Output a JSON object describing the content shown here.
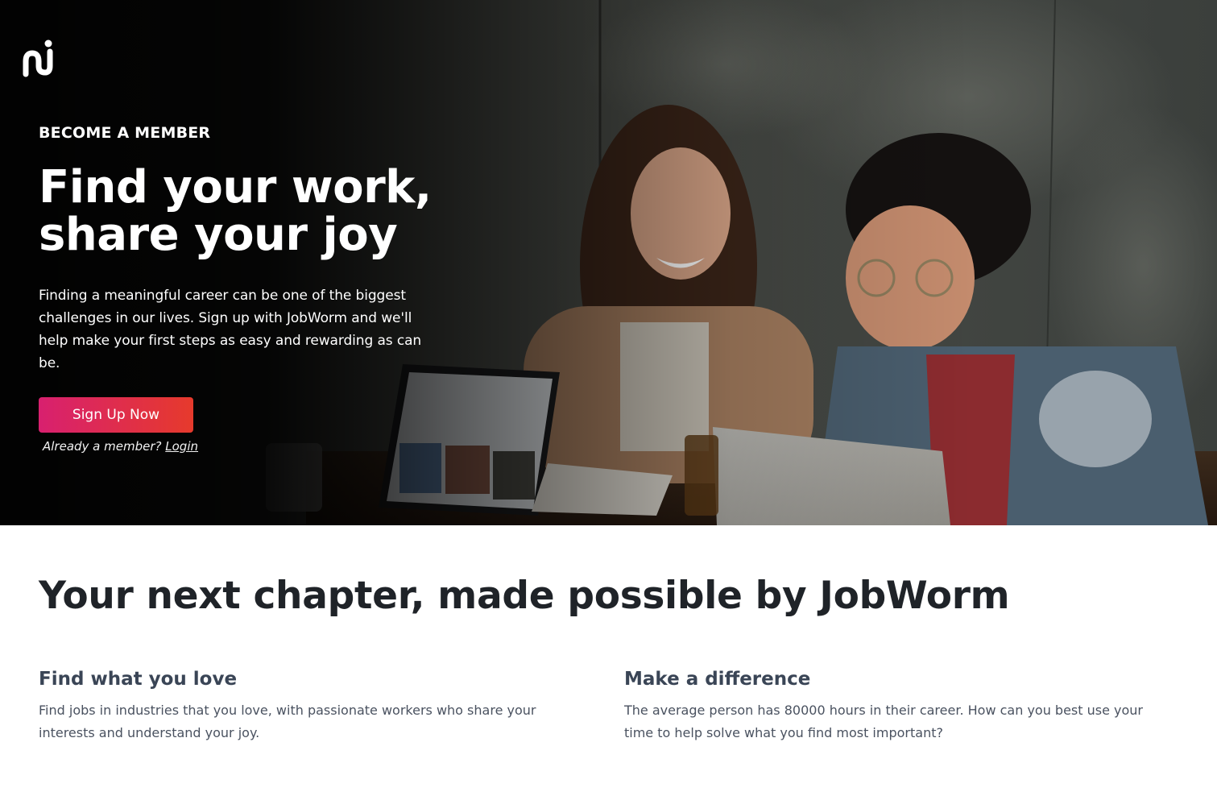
{
  "brand": {
    "logo_icon": "jobworm-logo-icon",
    "accent_start": "#d8206f",
    "accent_end": "#e63a2c"
  },
  "hero": {
    "eyebrow": "BECOME A MEMBER",
    "title": "Find your work, share your joy",
    "description": "Finding a meaningful career can be one of the biggest challenges in our lives. Sign up with JobWorm and we'll help make your first steps as easy and rewarding as can be.",
    "cta_label": "Sign Up Now",
    "login_prompt": "Already a member?",
    "login_label": "Login"
  },
  "section": {
    "title": "Your next chapter, made possible by JobWorm"
  },
  "features": [
    {
      "title": "Find what you love",
      "text": "Find jobs in industries that you love, with passionate workers who share your interests and understand your joy."
    },
    {
      "title": "Make a difference",
      "text": "The average person has 80000 hours in their career. How can you best use your time to help solve what you find most important?"
    }
  ]
}
